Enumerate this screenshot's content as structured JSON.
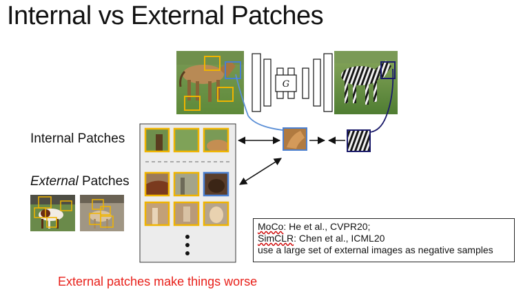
{
  "title": "Internal vs External Patches",
  "labels": {
    "internal": "Internal Patches",
    "external_italic": "External",
    "external_rest": " Patches"
  },
  "generator_symbol": "G",
  "references": {
    "moco_name": "MoCo",
    "moco_rest": ": He et al., CVPR20;",
    "simclr_name": "SimCLR",
    "simclr_rest": ": Chen et al., ICML20",
    "note": "use a large set of external images as negative samples"
  },
  "conclusion": "External patches make things worse",
  "colors": {
    "patch_border": "#f0b400",
    "query_border": "#4a7fd0",
    "zebra_link": "#1a1a6a",
    "horse_link": "#5b8fd6",
    "conclusion": "#e8201a"
  }
}
